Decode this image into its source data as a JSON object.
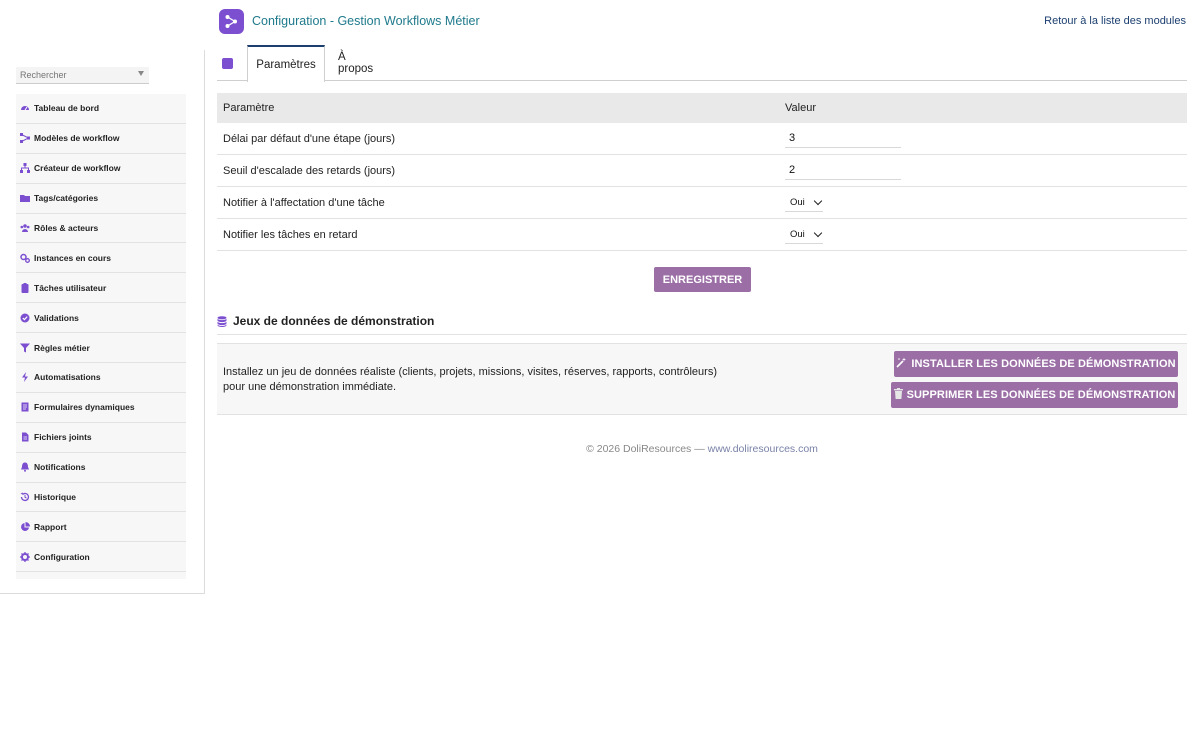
{
  "header": {
    "title": "Configuration - Gestion Workflows Métier",
    "back_link": "Retour à la liste des modules",
    "logo_icon": "workflow-icon"
  },
  "sidebar": {
    "search_placeholder": "Rechercher",
    "items": [
      {
        "label": "Tableau de bord",
        "icon": "dashboard-icon"
      },
      {
        "label": "Modèles de workflow",
        "icon": "workflow-icon"
      },
      {
        "label": "Créateur de workflow",
        "icon": "sitemap-icon"
      },
      {
        "label": "Tags/catégories",
        "icon": "folder-icon"
      },
      {
        "label": "Rôles & acteurs",
        "icon": "users-icon"
      },
      {
        "label": "Instances en cours",
        "icon": "cogs-icon"
      },
      {
        "label": "Tâches utilisateur",
        "icon": "clipboard-icon"
      },
      {
        "label": "Validations",
        "icon": "check-circle-icon"
      },
      {
        "label": "Règles métier",
        "icon": "filter-icon"
      },
      {
        "label": "Automatisations",
        "icon": "bolt-icon"
      },
      {
        "label": "Formulaires dynamiques",
        "icon": "form-icon"
      },
      {
        "label": "Fichiers joints",
        "icon": "file-icon"
      },
      {
        "label": "Notifications",
        "icon": "bell-icon"
      },
      {
        "label": "Historique",
        "icon": "history-icon"
      },
      {
        "label": "Rapport",
        "icon": "pie-chart-icon"
      },
      {
        "label": "Configuration",
        "icon": "gear-icon"
      }
    ]
  },
  "tabs": [
    {
      "label": "Paramètres",
      "active": true
    },
    {
      "label": "À propos",
      "active": false
    }
  ],
  "params": {
    "col_param": "Paramètre",
    "col_value": "Valeur",
    "rows": [
      {
        "label": "Délai par défaut d'une étape (jours)",
        "value": "3"
      },
      {
        "label": "Seuil d'escalade des retards (jours)",
        "value": "2"
      },
      {
        "label": "Notifier à l'affectation d'une tâche",
        "value": "Oui"
      },
      {
        "label": "Notifier les tâches en retard",
        "value": "Oui"
      }
    ],
    "save_label": "ENREGISTRER"
  },
  "demo": {
    "title": "Jeux de données de démonstration",
    "description": "Installez un jeu de données réaliste (clients, projets, missions, visites, réserves, rapports, contrôleurs) pour une démonstration immédiate.",
    "install_label": "INSTALLER LES DONNÉES DE DÉMONSTRATION",
    "delete_label": "SUPPRIMER LES DONNÉES DE DÉMONSTRATION"
  },
  "footer": {
    "copyright": "© 2026 DoliResources —",
    "link": "www.doliresources.com"
  },
  "colors": {
    "accent": "#7b4fd0",
    "button": "#9b6fa6",
    "title": "#1f7a8c",
    "link": "#1c3f70"
  }
}
